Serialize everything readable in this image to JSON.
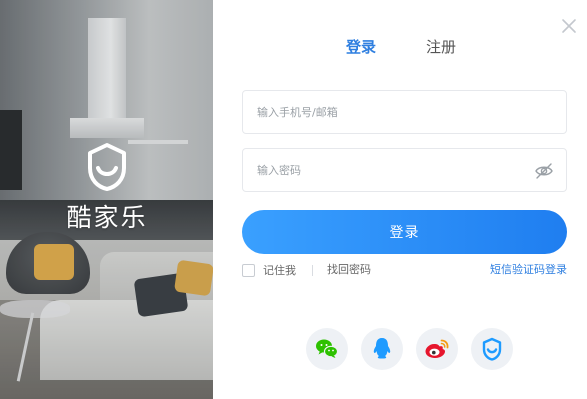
{
  "brand": {
    "name": "酷家乐"
  },
  "tabs": {
    "login": "登录",
    "register": "注册"
  },
  "form": {
    "phone_placeholder": "输入手机号/邮箱",
    "password_placeholder": "输入密码",
    "submit_label": "登录",
    "remember_label": "记住我",
    "forgot_label": "找回密码",
    "sms_login_label": "短信验证码登录"
  },
  "social": [
    "wechat-icon",
    "qq-icon",
    "weibo-icon",
    "kujiale-icon"
  ],
  "colors": {
    "accent": "#2f7fe0",
    "button_start": "#3aa0ff",
    "button_end": "#1f7ef0",
    "wechat": "#2dc100",
    "qq": "#1e9bff",
    "weibo": "#e6162d"
  },
  "icons": {
    "close": "close-icon",
    "password_toggle": "eye-off-icon",
    "logo": "kujiale-logo-icon"
  }
}
